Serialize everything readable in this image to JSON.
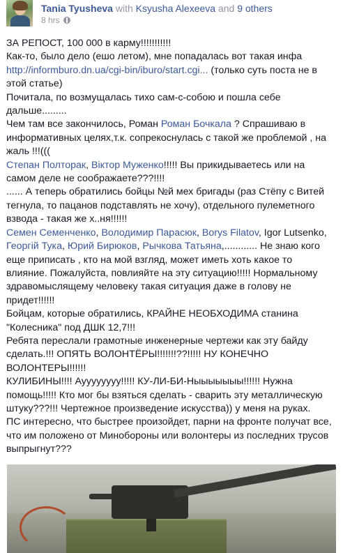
{
  "header": {
    "author": "Tania Tyusheva",
    "with_text": "with",
    "tagged_person": "Ksyusha Alexeeva",
    "and_text": "and",
    "others": "9 others",
    "timestamp": "8 hrs",
    "privacy_icon": "globe-icon"
  },
  "post": {
    "l1": "ЗА РЕПОСТ, 100 000 в карму!!!!!!!!!!!",
    "l2": "Как-то, было дело (ешо летом), мне попадалась вот такая инфа",
    "link_url": "http://informburo.dn.ua/cgi-bin/iburo/start.cgi...",
    "l3_after": " (только суть поста не в этой статье)",
    "l4": "Почитала, по возмущалась тихо сам-с-собою и пошла себе дальше.........",
    "l5a": "Чем там все закончилось, Роман ",
    "mention_roman": "Роман Бочкала",
    "l5b": " ? Спрашиваю в информативных целях,т.к. сопрекоснулась с такой же проблемой , на жаль !!!(((",
    "mention_poltorak": "Степан Полторак",
    "sep1": ", ",
    "mention_muzhenko": "Віктор Муженко",
    "l6b": "!!!!! Вы прикидываетесь или на самом деле не соображаете???!!!!",
    "l7": "...... А теперь обратились бойцы №й мех бригады (раз Стёпу с Витей тегнула, то пацанов подставлять не хочу), отдельного пулеметного взвода - такая же х..ня!!!!!!",
    "mention_semenchenko": "Семен Семенченко",
    "mention_parasyuk": "Володимир Парасюк",
    "mention_filatov": "Borys Filatov",
    "l8_plain": ", Igor Lutsenko,",
    "mention_tuka": "Георгій Тука",
    "mention_biryukov": "Юрий Бирюков",
    "mention_rychkova": "Рычкова Татьяна",
    "l9b": ",............ Не знаю кого еще приписать , кто на мой взгляд, может иметь хоть какое то влияние. Пожалуйста, повлияйте на эту ситуацию!!!!! Нормальному здравомыслящему человеку такая ситуация даже в голову не придет!!!!!!",
    "l10": "Бойцам, которые обратились, КРАЙНЕ НЕОБХОДИМА станина \"Колесника\" под ДШК 12,7!!!",
    "l11": "Ребята переслали грамотные инженерные чертежи как эту байду сделать.!!! ОПЯТЬ ВОЛОНТЁРЫ!!!!!!!??!!!!! НУ КОНЕЧНО ВОЛОНТЕРЫ!!!!!!",
    "l12": "КУЛИБИНЫ!!!! Ауууууууу!!!!! КУ-ЛИ-БИ-Ныыыыыыы!!!!!! Нужна помощь!!!!! Кто мог бы взяться сделать - сварить эту металлическую штуку???!!! Чертежное произведение искусства)) у меня на руках.",
    "l13": "ПС интересно, что быстрее произойдет, парни на фронте получат все, что им положено от Минобороны или волонтеры из последних трусов выпрыгнут???"
  }
}
